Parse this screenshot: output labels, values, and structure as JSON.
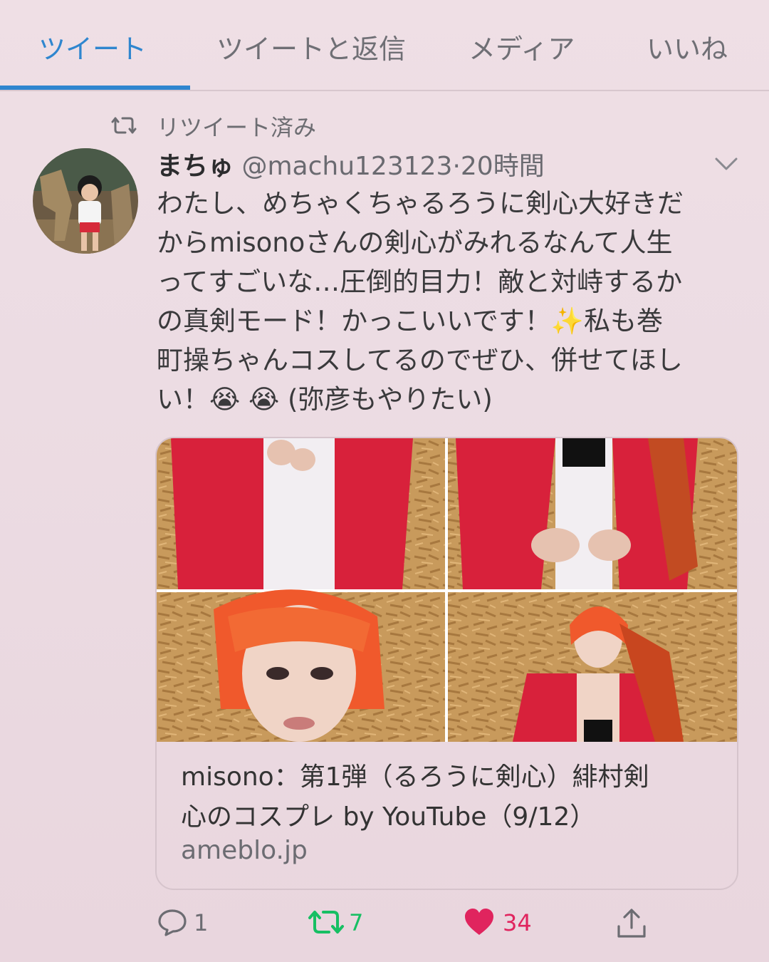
{
  "tabs": [
    {
      "label": "ツイート",
      "active": true
    },
    {
      "label": "ツイートと返信",
      "active": false
    },
    {
      "label": "メディア",
      "active": false
    },
    {
      "label": "いいね",
      "active": false
    }
  ],
  "retweet_label": "リツイート済み",
  "tweet": {
    "name": "まちゅ",
    "handle": "@machu123123",
    "separator": "·",
    "time": "20時間",
    "lines": [
      "わたし、めちゃくちゃるろうに剣心大好きだ",
      "からmisonoさんの剣心がみれるなんて人生",
      "ってすごいな…圧倒的目力！敵と対峙するか",
      "の真剣モード！かっこいいです！✨私も巻",
      "町操ちゃんコスしてるのでぜひ、併せてほし",
      "い！😭 😭 (弥彦もやりたい)"
    ]
  },
  "card": {
    "title_line1": "misono：第1弾（るろうに剣心）緋村剣",
    "title_line2": "心のコスプレ by YouTube（9/12）",
    "domain": "ameblo.jp"
  },
  "actions": {
    "reply_count": "1",
    "retweet_count": "7",
    "like_count": "34"
  },
  "colors": {
    "accent": "#2f86cf",
    "retweet_green": "#17bf63",
    "like_pink": "#e0245e"
  },
  "icons": [
    "retweet-icon",
    "chevron-down-icon",
    "reply-icon",
    "retweet-icon",
    "heart-icon",
    "share-icon"
  ]
}
